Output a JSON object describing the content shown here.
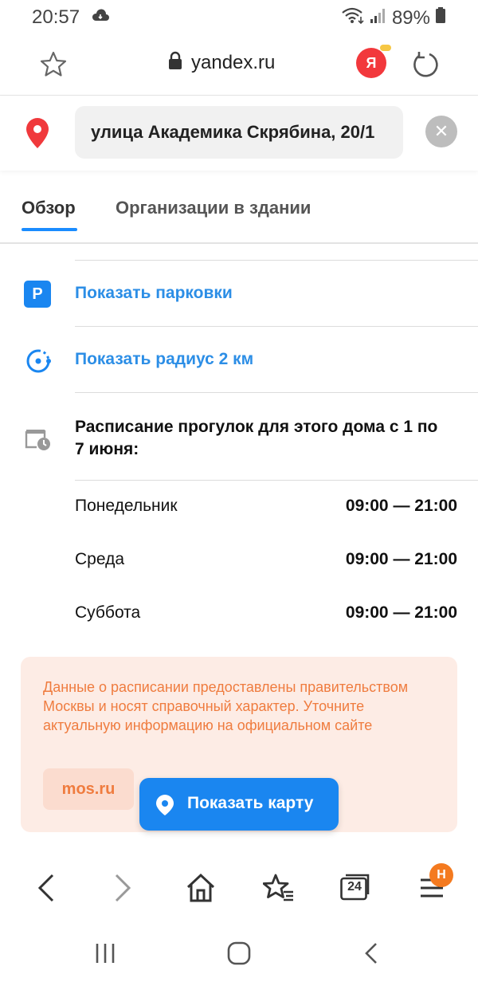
{
  "status": {
    "time": "20:57",
    "battery": "89%"
  },
  "browser": {
    "url": "yandex.ru",
    "yandex_letter": "Я",
    "tabs_count": "24",
    "menu_badge": "Н"
  },
  "address": {
    "value": "улица Академика Скрябина, 20/1"
  },
  "tabs": [
    {
      "label": "Обзор",
      "active": true
    },
    {
      "label": "Организации в здании",
      "active": false
    }
  ],
  "actions": {
    "parking_icon_text": "P",
    "parking_label": "Показать парковки",
    "radius_label": "Показать радиус 2 км"
  },
  "schedule": {
    "title": "Расписание прогулок для этого дома с 1 по 7 июня:",
    "rows": [
      {
        "day": "Понедельник",
        "time": "09:00 — 21:00"
      },
      {
        "day": "Среда",
        "time": "09:00 — 21:00"
      },
      {
        "day": "Суббота",
        "time": "09:00 — 21:00"
      }
    ]
  },
  "note": {
    "text": "Данные о расписании предоставлены правительством Москвы и носят справочный характер. Уточните актуальную информацию на официальном сайте",
    "link_label": "mos.ru"
  },
  "show_map": {
    "label": "Показать карту"
  },
  "colors": {
    "accent_blue": "#1a86f0",
    "link_blue": "#2c8ee6",
    "pin_red": "#f0393c",
    "note_bg": "#fdece5",
    "note_text": "#ef7c3f",
    "badge_orange": "#f47a1f"
  }
}
